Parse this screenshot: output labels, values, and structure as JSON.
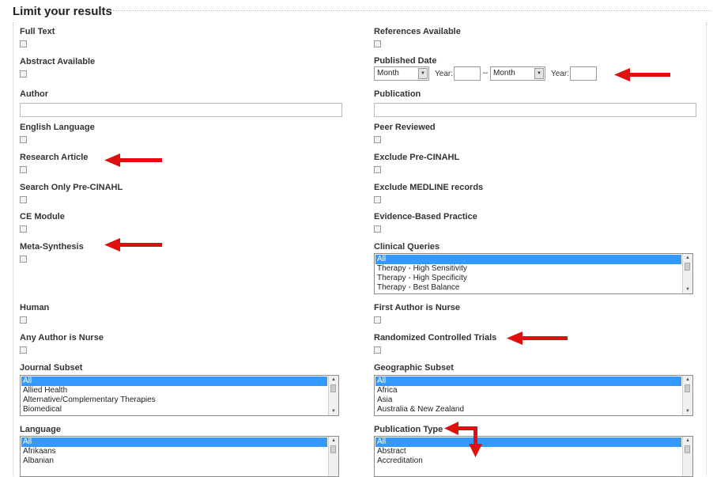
{
  "title": "Limit your results",
  "left": {
    "full_text": "Full Text",
    "abstract_available": "Abstract Available",
    "author": "Author",
    "english_language": "English Language",
    "research_article": "Research Article",
    "search_only_pre_cinahl": "Search Only Pre-CINAHL",
    "ce_module": "CE Module",
    "meta_synthesis": "Meta-Synthesis",
    "human": "Human",
    "any_author_is_nurse": "Any Author is Nurse",
    "journal_subset": {
      "label": "Journal Subset",
      "options": [
        "All",
        "Allied Health",
        "Alternative/Complementary Therapies",
        "Biomedical"
      ]
    },
    "language": {
      "label": "Language",
      "options": [
        "All",
        "Afrikaans",
        "Albanian"
      ]
    }
  },
  "right": {
    "references_available": "References Available",
    "published_date": {
      "label": "Published Date",
      "month_from": "Month",
      "year_label": "Year:",
      "dash": "–",
      "month_to": "Month",
      "year_label_to": "Year:"
    },
    "publication": "Publication",
    "peer_reviewed": "Peer Reviewed",
    "exclude_pre_cinahl": "Exclude Pre-CINAHL",
    "exclude_medline": "Exclude MEDLINE records",
    "evidence_based_practice": "Evidence-Based Practice",
    "clinical_queries": {
      "label": "Clinical Queries",
      "options": [
        "All",
        "Therapy - High Sensitivity",
        "Therapy - High Specificity",
        "Therapy - Best Balance"
      ]
    },
    "first_author_is_nurse": "First Author is Nurse",
    "randomized_controlled_trials": "Randomized Controlled Trials",
    "geographic_subset": {
      "label": "Geographic Subset",
      "options": [
        "All",
        "Africa",
        "Asia",
        "Australia & New Zealand"
      ]
    },
    "publication_type": {
      "label": "Publication Type",
      "options": [
        "All",
        "Abstract",
        "Accreditation"
      ]
    }
  },
  "colors": {
    "annotation_arrow": "#e01010",
    "selected_option": "#3399ff"
  }
}
